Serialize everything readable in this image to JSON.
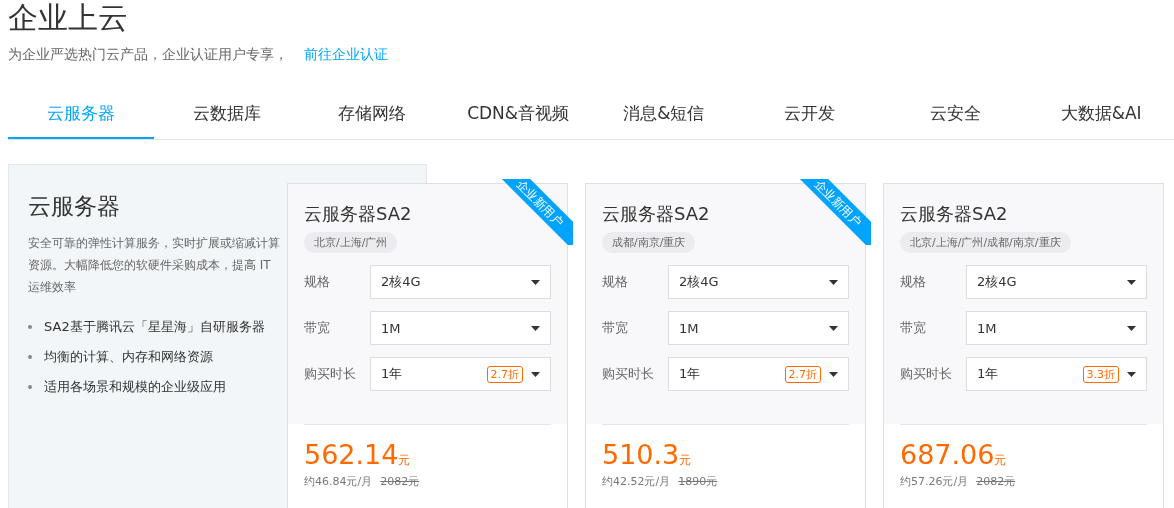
{
  "page": {
    "title": "企业上云",
    "subtitle": "为企业严选热门云产品，企业认证用户专享，",
    "link": "前往企业认证"
  },
  "tabs": [
    {
      "label": "云服务器",
      "selected": true
    },
    {
      "label": "云数据库",
      "selected": false
    },
    {
      "label": "存储网络",
      "selected": false
    },
    {
      "label": "CDN&音视频",
      "selected": false
    },
    {
      "label": "消息&短信",
      "selected": false
    },
    {
      "label": "云开发",
      "selected": false
    },
    {
      "label": "云安全",
      "selected": false
    },
    {
      "label": "大数据&AI",
      "selected": false
    }
  ],
  "intro": {
    "title": "云服务器",
    "description": "安全可靠的弹性计算服务，实时扩展或缩减计算资源。大幅降低您的软硬件采购成本，提高 IT 运维效率",
    "features": [
      "SA2基于腾讯云「星星海」自研服务器",
      "均衡的计算、内存和网络资源",
      "适用各场景和规模的企业级应用"
    ]
  },
  "products": [
    {
      "name": "云服务器SA2",
      "ribbon": "企业新用户",
      "regions": "北京/上海/广州",
      "options": [
        {
          "label": "规格",
          "value": "2核4G"
        },
        {
          "label": "带宽",
          "value": "1M"
        },
        {
          "label": "购买时长",
          "value": "1年",
          "discount": "2.7折"
        }
      ],
      "price": "562.14",
      "unit": "元",
      "monthly": "约46.84元/月",
      "original": "2082元"
    },
    {
      "name": "云服务器SA2",
      "ribbon": "企业新用户",
      "regions": "成都/南京/重庆",
      "options": [
        {
          "label": "规格",
          "value": "2核4G"
        },
        {
          "label": "带宽",
          "value": "1M"
        },
        {
          "label": "购买时长",
          "value": "1年",
          "discount": "2.7折"
        }
      ],
      "price": "510.3",
      "unit": "元",
      "monthly": "约42.52元/月",
      "original": "1890元"
    },
    {
      "name": "云服务器SA2",
      "regions": "北京/上海/广州/成都/南京/重庆",
      "options": [
        {
          "label": "规格",
          "value": "2核4G"
        },
        {
          "label": "带宽",
          "value": "1M"
        },
        {
          "label": "购买时长",
          "value": "1年",
          "discount": "3.3折"
        }
      ],
      "price": "687.06",
      "unit": "元",
      "monthly": "约57.26元/月",
      "original": "2082元"
    }
  ]
}
